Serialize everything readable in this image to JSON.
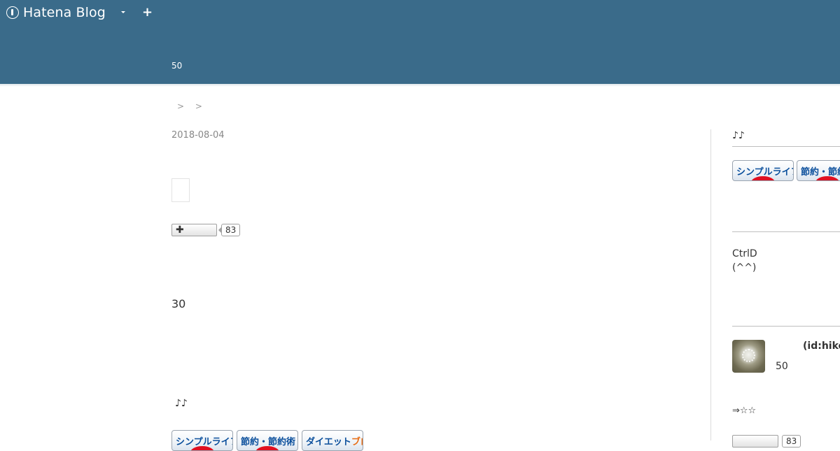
{
  "header": {
    "brand_name": "Hatena Blog",
    "plus_label": "+",
    "blog_description": "50"
  },
  "breadcrumb": {
    "separators": [
      ">",
      ">"
    ]
  },
  "entry": {
    "date": "2018-08-04",
    "bookmark_count": "83",
    "section_number": "30",
    "notes": "♪♪",
    "banners": [
      "シンプルライフ",
      "節約・節約術",
      "ダイエット",
      "ブログ"
    ]
  },
  "sidebar": {
    "notes": "♪♪",
    "banners": [
      "シンプルライフ",
      "節約・節約"
    ],
    "ctrl_line1": "CtrlD",
    "ctrl_line2": "(^^)",
    "profile_id": "(id:hike",
    "profile_number": "50",
    "stars": "⇒☆☆",
    "bookmark_count": "83"
  },
  "colors": {
    "header_bg": "#3a6b8a",
    "banner_text": "#0b4f9c",
    "banner_accent": "#e86a10"
  },
  "icons": {
    "brand": "hatena-logo-icon",
    "dropdown": "caret-down-icon",
    "add": "plus-icon",
    "bookmark_add": "plus-icon"
  }
}
